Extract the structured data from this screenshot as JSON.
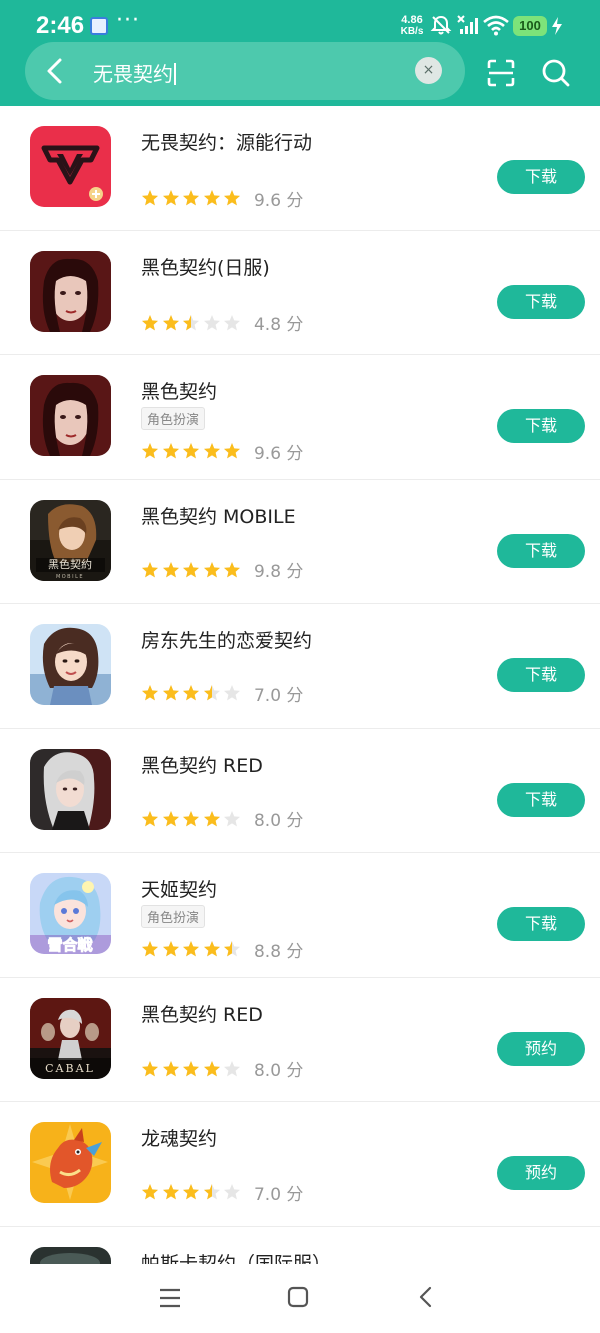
{
  "status_bar": {
    "time": "2:46",
    "more": "···",
    "speed_value": "4.86",
    "speed_unit": "KB/s",
    "battery": "100"
  },
  "search": {
    "query": "无畏契约",
    "clear_icon": "×"
  },
  "colors": {
    "accent": "#1fb89a",
    "star_filled": "#fbbd1c",
    "star_empty": "#e6e6e6"
  },
  "results": [
    {
      "title": "无畏契约：源能行动",
      "tag": "",
      "stars": 5,
      "score": "9.6 分",
      "button": "下载",
      "icon": "valorant-mobile-icon"
    },
    {
      "title": "黑色契约(日服)",
      "tag": "",
      "stars": 2.5,
      "score": "4.8 分",
      "button": "下载",
      "icon": "black-contract-jp-icon"
    },
    {
      "title": "黑色契约",
      "tag": "角色扮演",
      "stars": 5,
      "score": "9.6 分",
      "button": "下载",
      "icon": "black-contract-icon"
    },
    {
      "title": "黑色契约 MOBILE",
      "tag": "",
      "stars": 5,
      "score": "9.8 分",
      "button": "下载",
      "icon": "black-contract-mobile-icon"
    },
    {
      "title": "房东先生的恋爱契约",
      "tag": "",
      "stars": 3.5,
      "score": "7.0 分",
      "button": "下载",
      "icon": "landlord-love-contract-icon"
    },
    {
      "title": "黑色契约 RED",
      "tag": "",
      "stars": 4,
      "score": "8.0 分",
      "button": "下载",
      "icon": "black-contract-red-icon"
    },
    {
      "title": "天姬契约",
      "tag": "角色扮演",
      "stars": 4.5,
      "score": "8.8 分",
      "button": "下载",
      "icon": "tianji-contract-icon"
    },
    {
      "title": "黑色契约 RED",
      "tag": "",
      "stars": 4,
      "score": "8.0 分",
      "button": "预约",
      "icon": "cabal-red-icon"
    },
    {
      "title": "龙魂契约",
      "tag": "",
      "stars": 3.5,
      "score": "7.0 分",
      "button": "预约",
      "icon": "dragon-soul-contract-icon"
    },
    {
      "title": "帕斯卡契约（国际服）",
      "tag": "",
      "stars": 0,
      "score": "",
      "button": "",
      "icon": "pascal-contract-icon"
    }
  ]
}
